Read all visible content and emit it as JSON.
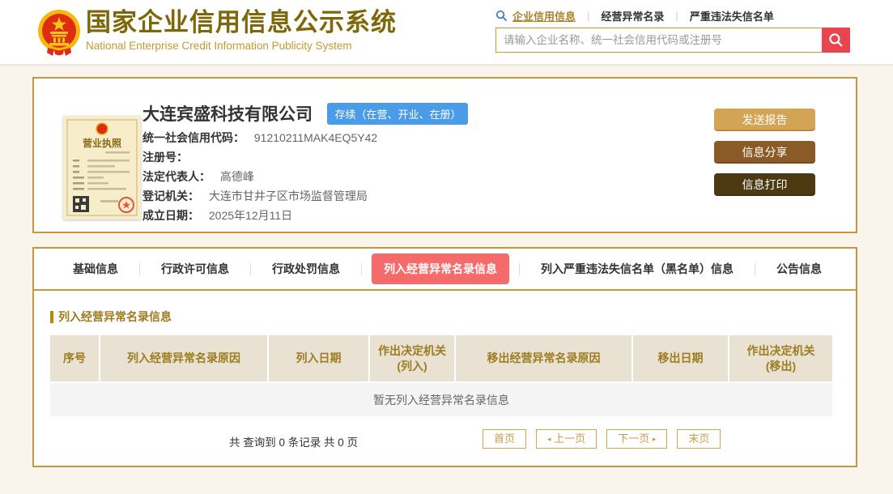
{
  "header": {
    "title_cn": "国家企业信用信息公示系统",
    "title_en": "National Enterprise Credit Information Publicity System",
    "nav_links": [
      {
        "label": "企业信用信息"
      },
      {
        "label": "经营异常名录"
      },
      {
        "label": "严重违法失信名单"
      }
    ],
    "search_placeholder": "请输入企业名称、统一社会信用代码或注册号"
  },
  "company": {
    "name": "大连宾盛科技有限公司",
    "status_badge": "存续（在营、开业、在册）",
    "license_label": "营业执照",
    "fields": [
      {
        "label": "统一社会信用代码：",
        "value": "91210211MAK4EQ5Y42"
      },
      {
        "label": "注册号：",
        "value": ""
      },
      {
        "label": "法定代表人：",
        "value": "高德峰"
      },
      {
        "label": "登记机关：",
        "value": "大连市甘井子区市场监督管理局"
      },
      {
        "label": "成立日期：",
        "value": "2025年12月11日"
      }
    ],
    "actions": [
      {
        "label": "发送报告"
      },
      {
        "label": "信息分享"
      },
      {
        "label": "信息打印"
      }
    ]
  },
  "tabs": [
    {
      "label": "基础信息",
      "active": false
    },
    {
      "label": "行政许可信息",
      "active": false
    },
    {
      "label": "行政处罚信息",
      "active": false
    },
    {
      "label": "列入经营异常名录信息",
      "active": true
    },
    {
      "label": "列入严重违法失信名单（黑名单）信息",
      "active": false
    },
    {
      "label": "公告信息",
      "active": false
    }
  ],
  "section_title": "列入经营异常名录信息",
  "table": {
    "headers": [
      "序号",
      "列入经营异常名录原因",
      "列入日期",
      "作出决定机关\n(列入)",
      "移出经营异常名录原因",
      "移出日期",
      "作出决定机关\n(移出)"
    ],
    "empty_text": "暂无列入经营异常名录信息"
  },
  "pagination": {
    "summary": "共 查询到 0 条记录 共 0 页",
    "first": "首页",
    "prev": "上一页",
    "next": "下一页",
    "last": "末页",
    "prev_arrow": "◂",
    "next_arrow": "▸"
  },
  "colors": {
    "accent_gold": "#c9973b",
    "title_gold": "#7d6708",
    "active_tab_red": "#f56a6a",
    "status_blue": "#4a9ce8",
    "search_button_red": "#e8464e",
    "btn_send": "#d4a455",
    "btn_share": "#8a5b26",
    "btn_print": "#4d3a12",
    "table_header_bg": "#e9e1d2",
    "table_header_text": "#9d7d20"
  }
}
